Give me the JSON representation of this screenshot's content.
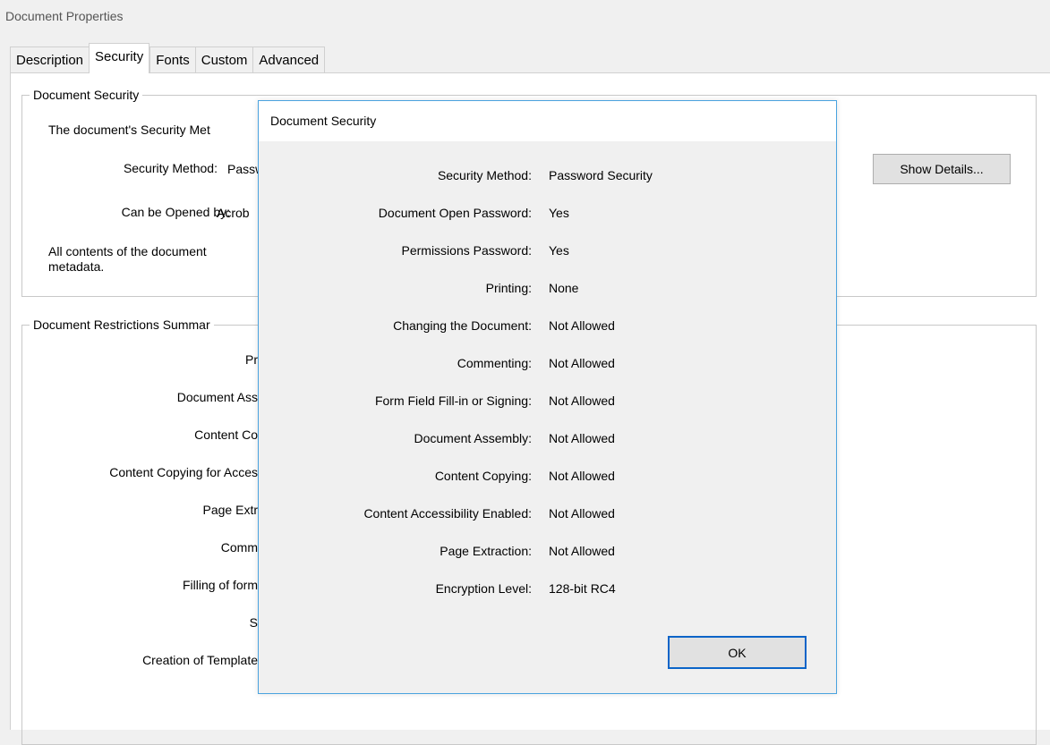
{
  "window": {
    "title": "Document Properties"
  },
  "tabs": [
    {
      "label": "Description",
      "active": false
    },
    {
      "label": "Security",
      "active": true
    },
    {
      "label": "Fonts",
      "active": false
    },
    {
      "label": "Custom",
      "active": false
    },
    {
      "label": "Advanced",
      "active": false
    }
  ],
  "document_security_group": {
    "legend": "Document Security",
    "intro_text": "The document's Security Met",
    "security_method_label": "Security Method:",
    "security_method_value": "Passw",
    "opened_by_label": "Can be Opened by:",
    "opened_by_value": "Acrob",
    "encrypt_note_line1": "All contents of the document",
    "encrypt_note_line2": "metadata.",
    "show_details_label": "Show Details..."
  },
  "restrictions_group": {
    "legend": "Document Restrictions Summar",
    "labels": [
      "Pr",
      "Document Ass",
      "Content Co",
      "Content Copying for Acces",
      "Page Extr",
      "Comm",
      "Filling of form",
      "S",
      "Creation of Template"
    ]
  },
  "modal": {
    "title": "Document Security",
    "rows": [
      {
        "label": "Security Method:",
        "value": "Password Security"
      },
      {
        "label": "Document Open Password:",
        "value": "Yes"
      },
      {
        "label": "Permissions Password:",
        "value": "Yes"
      },
      {
        "label": "Printing:",
        "value": "None"
      },
      {
        "label": "Changing the Document:",
        "value": "Not Allowed"
      },
      {
        "label": "Commenting:",
        "value": "Not Allowed"
      },
      {
        "label": "Form Field Fill-in or Signing:",
        "value": "Not Allowed"
      },
      {
        "label": "Document Assembly:",
        "value": "Not Allowed"
      },
      {
        "label": "Content Copying:",
        "value": "Not Allowed"
      },
      {
        "label": "Content Accessibility Enabled:",
        "value": "Not Allowed"
      },
      {
        "label": "Page Extraction:",
        "value": "Not Allowed"
      },
      {
        "label": "Encryption Level:",
        "value": "128-bit RC4"
      }
    ],
    "ok_label": "OK"
  },
  "colors": {
    "dialog_background": "#f0f0f0",
    "panel_background": "#ffffff",
    "modal_border": "#4aa3df",
    "ok_button_border": "#0a64c8"
  }
}
